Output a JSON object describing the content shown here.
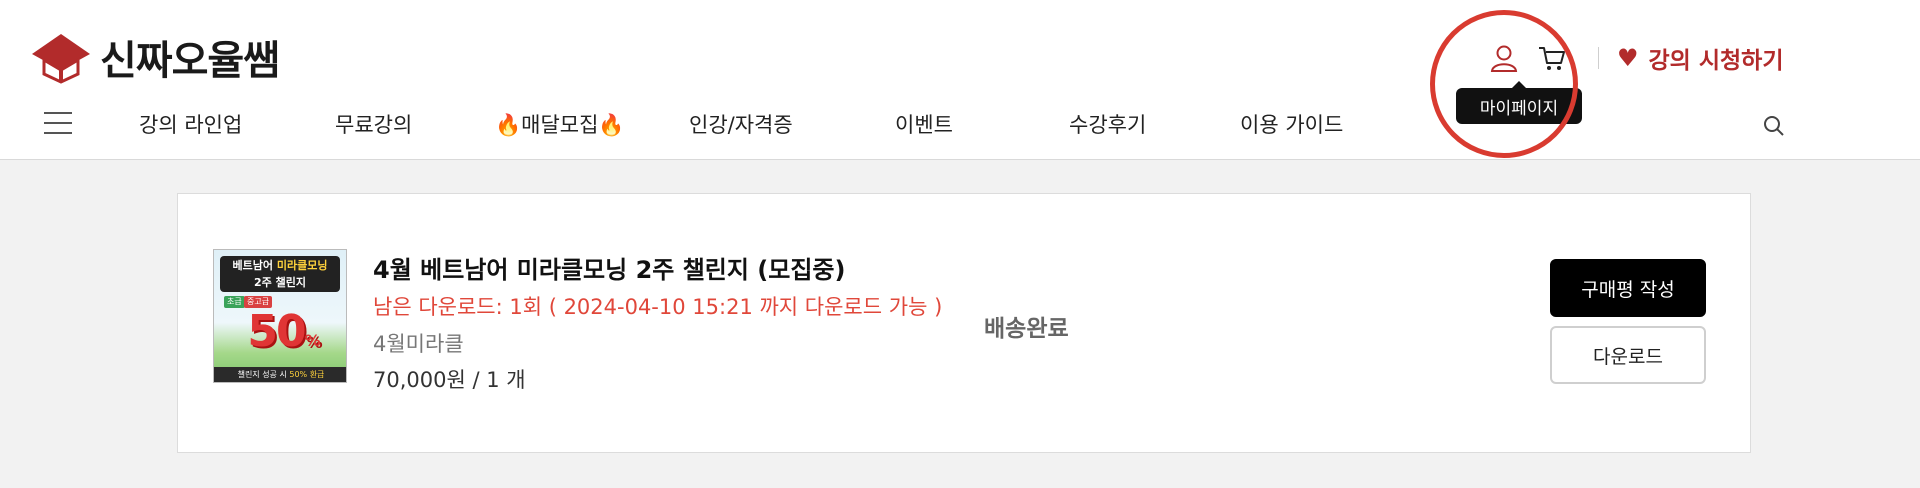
{
  "brand": {
    "name": "신짜오율쌤",
    "accent": "#b22b2b",
    "logo_icon": "graduation-cap-house-icon"
  },
  "header": {
    "icons": [
      "user-icon",
      "cart-icon"
    ],
    "tooltip": "마이페이지",
    "watch_label": "강의 시청하기",
    "watch_icon": "heart-icon"
  },
  "nav": {
    "items": [
      "강의 라인업",
      "무료강의",
      "🔥매달모집🔥",
      "인강/자격증",
      "이벤트",
      "수강후기",
      "이용 가이드"
    ],
    "menu_icon": "hamburger-icon",
    "search_icon": "search-icon"
  },
  "order": {
    "thumbnail": {
      "title_line1_a": "베트남어",
      "title_line1_b": "미라클모닝",
      "title_line2": "2주 챌린지",
      "tag1": "초급",
      "tag2": "중고급",
      "big": "50",
      "big_unit": "%",
      "footer_a": "챌린지 성공 시",
      "footer_b": "50% 환급"
    },
    "title": "4월 베트남어 미라클모닝 2주 챌린지 (모집중)",
    "download_info": "남은 다운로드: 1회 ( 2024-04-10 15:21 까지 다운로드 가능 )",
    "option": "4월미라클",
    "price": "70,000원 / 1 개",
    "status": "배송완료",
    "review_button": "구매평 작성",
    "download_button": "다운로드"
  },
  "colors": {
    "highlight_circle": "#d93b30",
    "download_info": "#e0473a"
  }
}
